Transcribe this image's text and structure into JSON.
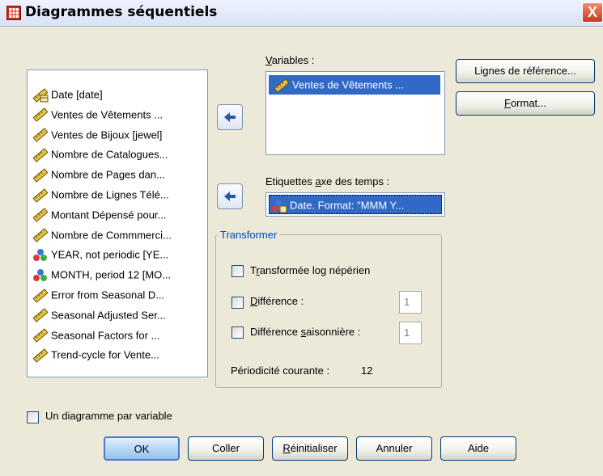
{
  "window": {
    "title": "Diagrammes séquentiels",
    "close_label": "X"
  },
  "source_list": {
    "items": [
      {
        "label": "Date [date]",
        "icon": "date-ruler-icon"
      },
      {
        "label": "Ventes de Vêtements ...",
        "icon": "scale-ruler-icon"
      },
      {
        "label": "Ventes de Bijoux [jewel]",
        "icon": "scale-ruler-icon"
      },
      {
        "label": "Nombre de Catalogues...",
        "icon": "scale-ruler-icon"
      },
      {
        "label": "Nombre de Pages dan...",
        "icon": "scale-ruler-icon"
      },
      {
        "label": "Nombre de Lignes Télé...",
        "icon": "scale-ruler-icon"
      },
      {
        "label": "Montant Dépensé pour...",
        "icon": "scale-ruler-icon"
      },
      {
        "label": "Nombre de Commmerci...",
        "icon": "scale-ruler-icon"
      },
      {
        "label": "YEAR, not periodic [YE...",
        "icon": "nominal-balls-icon"
      },
      {
        "label": "MONTH, period 12 [MO...",
        "icon": "nominal-balls-icon"
      },
      {
        "label": "Error from Seasonal D...",
        "icon": "scale-ruler-icon"
      },
      {
        "label": "Seasonal Adjusted Ser...",
        "icon": "scale-ruler-icon"
      },
      {
        "label": "Seasonal Factors for ...",
        "icon": "scale-ruler-icon"
      },
      {
        "label": "Trend-cycle for Vente...",
        "icon": "scale-ruler-icon"
      }
    ]
  },
  "variables": {
    "label_pre": "",
    "label_ul": "V",
    "label_post": "ariables :",
    "items": [
      "Ventes de Vêtements ..."
    ]
  },
  "time_axis": {
    "label_pre": "Etiquettes ",
    "label_ul": "a",
    "label_post": "xe des temps :",
    "value": "Date. Format: \"MMM Y..."
  },
  "side_buttons": {
    "reference_lines": "Lignes de référence...",
    "format_pre": "",
    "format_ul": "F",
    "format_post": "ormat..."
  },
  "transform": {
    "title": "Transformer",
    "log": {
      "pre": "T",
      "ul": "r",
      "post": "ansformée log népérien"
    },
    "diff": {
      "pre": "",
      "ul": "D",
      "post": "ifférence :",
      "value": "1"
    },
    "seasonal_diff": {
      "pre": "Différence ",
      "ul": "s",
      "post": "aisonnière :",
      "value": "1"
    },
    "periodicity_label": "Périodicité courante :",
    "periodicity_value": "12"
  },
  "one_chart_per_var": {
    "label": "Un diagramme par variable"
  },
  "buttons": {
    "ok": "OK",
    "paste": "Coller",
    "reset_pre": "",
    "reset_ul": "R",
    "reset_post": "éinitialiser",
    "cancel": "Annuler",
    "help": "Aide"
  },
  "colors": {
    "selection": "#3169c6",
    "group_title": "#0046d5"
  }
}
